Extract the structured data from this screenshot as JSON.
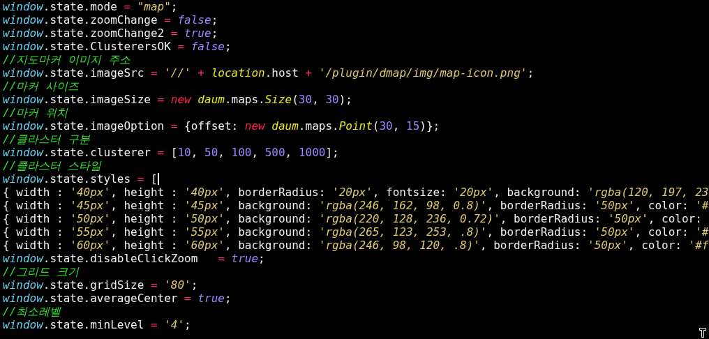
{
  "editor": {
    "lines": [
      {
        "tokens": [
          {
            "kind": "obj",
            "text": "window"
          },
          {
            "kind": "plain",
            "text": ".state.mode"
          },
          {
            "kind": "op",
            "text": " = "
          },
          {
            "kind": "str",
            "text": "\"map\""
          },
          {
            "kind": "plain",
            "text": ";"
          }
        ]
      },
      {
        "tokens": [
          {
            "kind": "obj",
            "text": "window"
          },
          {
            "kind": "plain",
            "text": ".state.zoomChange"
          },
          {
            "kind": "op",
            "text": " = "
          },
          {
            "kind": "bool",
            "text": "false"
          },
          {
            "kind": "plain",
            "text": ";"
          }
        ]
      },
      {
        "tokens": [
          {
            "kind": "obj",
            "text": "window"
          },
          {
            "kind": "plain",
            "text": ".state.zoomChange2"
          },
          {
            "kind": "op",
            "text": " = "
          },
          {
            "kind": "bool",
            "text": "true"
          },
          {
            "kind": "plain",
            "text": ";"
          }
        ]
      },
      {
        "tokens": [
          {
            "kind": "obj",
            "text": "window"
          },
          {
            "kind": "plain",
            "text": ".state.ClusterersOK"
          },
          {
            "kind": "op",
            "text": " = "
          },
          {
            "kind": "bool",
            "text": "false"
          },
          {
            "kind": "plain",
            "text": ";"
          }
        ]
      },
      {
        "tokens": [
          {
            "kind": "comment",
            "text": "//지도마커 이미지 주소"
          }
        ]
      },
      {
        "tokens": [
          {
            "kind": "obj",
            "text": "window"
          },
          {
            "kind": "plain",
            "text": ".state.imageSrc"
          },
          {
            "kind": "op",
            "text": " = "
          },
          {
            "kind": "str",
            "text": "'//'"
          },
          {
            "kind": "op",
            "text": " + "
          },
          {
            "kind": "cls",
            "text": "location"
          },
          {
            "kind": "plain",
            "text": ".host"
          },
          {
            "kind": "op",
            "text": " + "
          },
          {
            "kind": "str",
            "text": "'/plugin/dmap/img/map-icon.png'"
          },
          {
            "kind": "plain",
            "text": ";"
          }
        ]
      },
      {
        "tokens": [
          {
            "kind": "comment",
            "text": "//마커 사이즈"
          }
        ]
      },
      {
        "tokens": [
          {
            "kind": "obj",
            "text": "window"
          },
          {
            "kind": "plain",
            "text": ".state.imageSize"
          },
          {
            "kind": "op",
            "text": " = "
          },
          {
            "kind": "kw",
            "text": "new "
          },
          {
            "kind": "cls",
            "text": "daum"
          },
          {
            "kind": "plain",
            "text": ".maps."
          },
          {
            "kind": "cls",
            "text": "Size"
          },
          {
            "kind": "plain",
            "text": "("
          },
          {
            "kind": "num",
            "text": "30"
          },
          {
            "kind": "plain",
            "text": ", "
          },
          {
            "kind": "num",
            "text": "30"
          },
          {
            "kind": "plain",
            "text": ");"
          }
        ]
      },
      {
        "tokens": [
          {
            "kind": "comment",
            "text": "//마커 위치"
          }
        ]
      },
      {
        "tokens": [
          {
            "kind": "obj",
            "text": "window"
          },
          {
            "kind": "plain",
            "text": ".state.imageOption"
          },
          {
            "kind": "op",
            "text": " = "
          },
          {
            "kind": "plain",
            "text": "{offset: "
          },
          {
            "kind": "kw",
            "text": "new "
          },
          {
            "kind": "cls",
            "text": "daum"
          },
          {
            "kind": "plain",
            "text": ".maps."
          },
          {
            "kind": "cls",
            "text": "Point"
          },
          {
            "kind": "plain",
            "text": "("
          },
          {
            "kind": "num",
            "text": "30"
          },
          {
            "kind": "plain",
            "text": ", "
          },
          {
            "kind": "num",
            "text": "15"
          },
          {
            "kind": "plain",
            "text": ")};"
          }
        ]
      },
      {
        "tokens": [
          {
            "kind": "comment",
            "text": "//클라스터 구분"
          }
        ]
      },
      {
        "tokens": [
          {
            "kind": "obj",
            "text": "window"
          },
          {
            "kind": "plain",
            "text": ".state.clusterer"
          },
          {
            "kind": "op",
            "text": " = "
          },
          {
            "kind": "plain",
            "text": "["
          },
          {
            "kind": "num",
            "text": "10"
          },
          {
            "kind": "plain",
            "text": ", "
          },
          {
            "kind": "num",
            "text": "50"
          },
          {
            "kind": "plain",
            "text": ", "
          },
          {
            "kind": "num",
            "text": "100"
          },
          {
            "kind": "plain",
            "text": ", "
          },
          {
            "kind": "num",
            "text": "500"
          },
          {
            "kind": "plain",
            "text": ", "
          },
          {
            "kind": "num",
            "text": "1000"
          },
          {
            "kind": "plain",
            "text": "];"
          }
        ]
      },
      {
        "tokens": [
          {
            "kind": "comment",
            "text": "//클라스터 스타일"
          }
        ]
      },
      {
        "tokens": [
          {
            "kind": "obj",
            "text": "window"
          },
          {
            "kind": "plain",
            "text": ".state.styles"
          },
          {
            "kind": "op",
            "text": " = "
          },
          {
            "kind": "plain",
            "text": "["
          }
        ],
        "cursor": true
      },
      {
        "tokens": [
          {
            "kind": "plain",
            "text": "{ width : "
          },
          {
            "kind": "str",
            "text": "'40px'"
          },
          {
            "kind": "plain",
            "text": ", height : "
          },
          {
            "kind": "str",
            "text": "'40px'"
          },
          {
            "kind": "plain",
            "text": ", borderRadius: "
          },
          {
            "kind": "str",
            "text": "'20px'"
          },
          {
            "kind": "plain",
            "text": ", fontsize: "
          },
          {
            "kind": "str",
            "text": "'20px'"
          },
          {
            "kind": "plain",
            "text": ", background: "
          },
          {
            "kind": "str",
            "text": "'rgba(120, 197, 23"
          }
        ]
      },
      {
        "tokens": [
          {
            "kind": "plain",
            "text": "{ width : "
          },
          {
            "kind": "str",
            "text": "'45px'"
          },
          {
            "kind": "plain",
            "text": ", height : "
          },
          {
            "kind": "str",
            "text": "'45px'"
          },
          {
            "kind": "plain",
            "text": ", background: "
          },
          {
            "kind": "str",
            "text": "'rgba(246, 162, 98, 0.8)'"
          },
          {
            "kind": "plain",
            "text": ", borderRadius: "
          },
          {
            "kind": "str",
            "text": "'50px'"
          },
          {
            "kind": "plain",
            "text": ", color: "
          },
          {
            "kind": "str",
            "text": "'#"
          }
        ]
      },
      {
        "tokens": [
          {
            "kind": "plain",
            "text": "{ width : "
          },
          {
            "kind": "str",
            "text": "'50px'"
          },
          {
            "kind": "plain",
            "text": ", height : "
          },
          {
            "kind": "str",
            "text": "'50px'"
          },
          {
            "kind": "plain",
            "text": ", background: "
          },
          {
            "kind": "str",
            "text": "'rgba(220, 128, 236, 0.72)'"
          },
          {
            "kind": "plain",
            "text": ", borderRadius: "
          },
          {
            "kind": "str",
            "text": "'50px'"
          },
          {
            "kind": "plain",
            "text": ", color:"
          }
        ]
      },
      {
        "tokens": [
          {
            "kind": "plain",
            "text": "{ width : "
          },
          {
            "kind": "str",
            "text": "'55px'"
          },
          {
            "kind": "plain",
            "text": ", height : "
          },
          {
            "kind": "str",
            "text": "'55px'"
          },
          {
            "kind": "plain",
            "text": ", background: "
          },
          {
            "kind": "str",
            "text": "'rgba(265, 123, 253, .8)'"
          },
          {
            "kind": "plain",
            "text": ", borderRadius: "
          },
          {
            "kind": "str",
            "text": "'50px'"
          },
          {
            "kind": "plain",
            "text": ", color: "
          },
          {
            "kind": "str",
            "text": "'#"
          }
        ]
      },
      {
        "tokens": [
          {
            "kind": "plain",
            "text": "{ width : "
          },
          {
            "kind": "str",
            "text": "'60px'"
          },
          {
            "kind": "plain",
            "text": ", height : "
          },
          {
            "kind": "str",
            "text": "'60px'"
          },
          {
            "kind": "plain",
            "text": ", background: "
          },
          {
            "kind": "str",
            "text": "'rgba(246, 98, 120, .8)'"
          },
          {
            "kind": "plain",
            "text": ", borderRadius: "
          },
          {
            "kind": "str",
            "text": "'50px'"
          },
          {
            "kind": "plain",
            "text": ", color: "
          },
          {
            "kind": "str",
            "text": "'#f"
          }
        ]
      },
      {
        "tokens": [
          {
            "kind": "obj",
            "text": "window"
          },
          {
            "kind": "plain",
            "text": ".state.disableClickZoom"
          },
          {
            "kind": "op",
            "text": "   = "
          },
          {
            "kind": "bool",
            "text": "true"
          },
          {
            "kind": "plain",
            "text": ";"
          }
        ]
      },
      {
        "tokens": [
          {
            "kind": "comment",
            "text": "//그리드 크기"
          }
        ]
      },
      {
        "tokens": [
          {
            "kind": "obj",
            "text": "window"
          },
          {
            "kind": "plain",
            "text": ".state.gridSize"
          },
          {
            "kind": "op",
            "text": " = "
          },
          {
            "kind": "str",
            "text": "'80'"
          },
          {
            "kind": "plain",
            "text": ";"
          }
        ]
      },
      {
        "tokens": [
          {
            "kind": "obj",
            "text": "window"
          },
          {
            "kind": "plain",
            "text": ".state.averageCenter"
          },
          {
            "kind": "op",
            "text": " = "
          },
          {
            "kind": "bool",
            "text": "true"
          },
          {
            "kind": "plain",
            "text": ";"
          }
        ]
      },
      {
        "tokens": [
          {
            "kind": "comment",
            "text": "//최소레벨"
          }
        ]
      },
      {
        "tokens": [
          {
            "kind": "obj",
            "text": "window"
          },
          {
            "kind": "plain",
            "text": ".state.minLevel"
          },
          {
            "kind": "op",
            "text": " = "
          },
          {
            "kind": "str",
            "text": "'4'"
          },
          {
            "kind": "plain",
            "text": ";"
          }
        ]
      }
    ]
  }
}
